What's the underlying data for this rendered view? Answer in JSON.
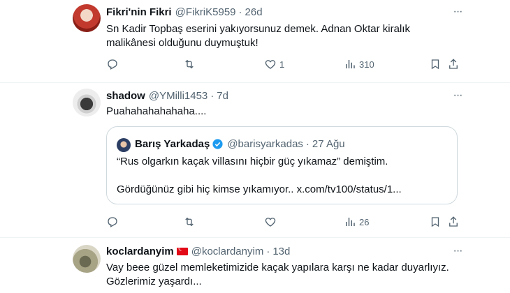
{
  "tweets": [
    {
      "name": "Fikri'nin Fikri",
      "handle": "@FikriK5959",
      "sep": "·",
      "time": "26d",
      "text_1": "Sn Kadir Topbaş eserini yakıyorsunuz demek. Adnan Oktar kiralık",
      "text_2": "malikânesi olduğunu duymuştuk!",
      "replies": "",
      "retweets": "",
      "likes": "1",
      "views": "310"
    },
    {
      "name": "shadow",
      "handle": "@YMilli1453",
      "sep": "·",
      "time": "7d",
      "text_1": "Puahahahahahaha....",
      "replies": "",
      "retweets": "",
      "likes": "",
      "views": "26",
      "quote": {
        "name": "Barış Yarkadaş",
        "handle": "@barisyarkadas",
        "sep": "·",
        "time": "27 Ağu",
        "text_1": "“Rus olgarkın kaçak villasını hiçbir güç yıkamaz” demiştim.",
        "text_2": "Gördüğünüz gibi hiç kimse yıkamıyor.. x.com/tv100/status/1..."
      }
    },
    {
      "name": "koclardanyim",
      "handle": "@koclardanyim",
      "sep": "·",
      "time": "13d",
      "text_1": "Vay beee güzel memleketimizide kaçak yapılara karşı ne kadar duyarlıyız.",
      "text_2": "Gözlerimiz yaşardı..."
    }
  ],
  "icons": {
    "more": "more-icon",
    "reply": "reply-icon",
    "retweet": "retweet-icon",
    "like": "heart-icon",
    "views": "views-icon",
    "bookmark": "bookmark-icon",
    "share": "share-icon",
    "verified": "verified-badge-icon",
    "flag": "turkey-flag-icon"
  },
  "colors": {
    "text": "#0f1419",
    "secondary": "#536471",
    "border": "#cfd9de",
    "divider": "#eff3f4",
    "verified": "#1d9bf0"
  }
}
